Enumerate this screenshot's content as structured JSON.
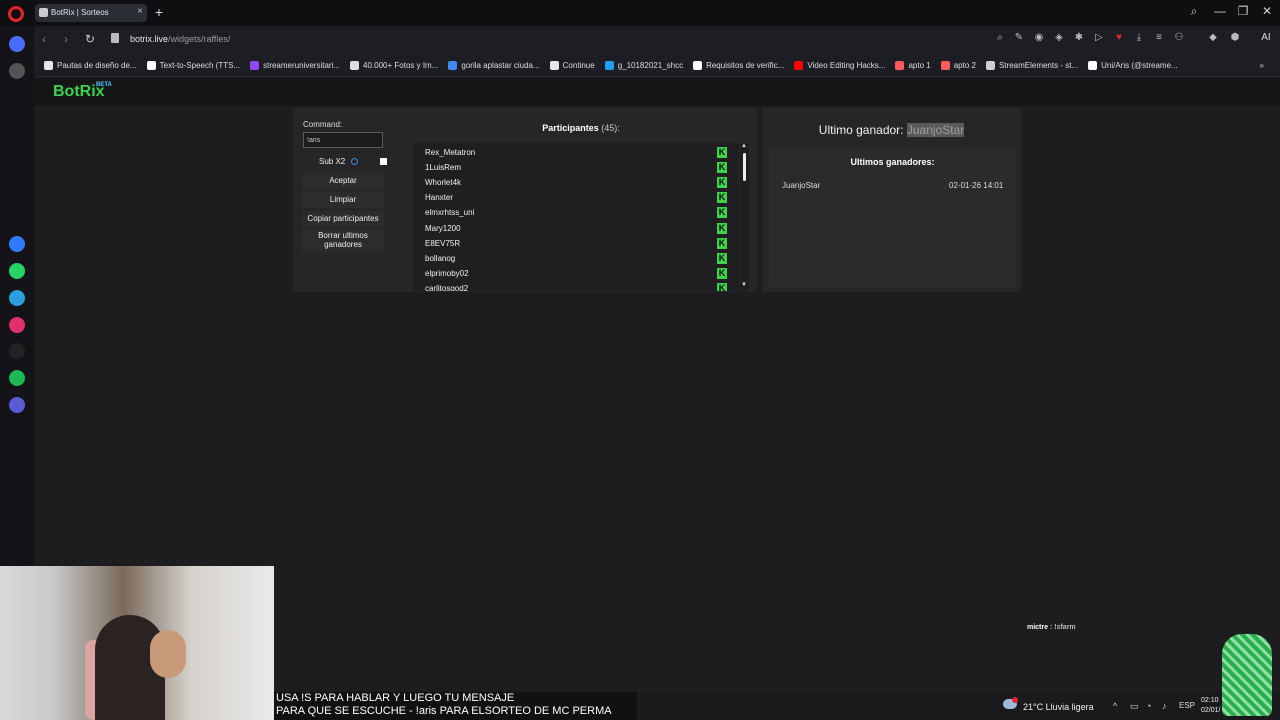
{
  "browser": {
    "tab_title": "BotRix | Sorteos",
    "tab_close": "×",
    "new_tab": "+",
    "url_host": "botrix.live",
    "url_path": "/widgets/raffles/",
    "ai_label": "AI",
    "window_controls": [
      "⌕",
      "—",
      "❐",
      "✕"
    ]
  },
  "bookmarks": [
    {
      "label": "Pautas de diseño de...",
      "color": "#e6e6e6"
    },
    {
      "label": "Text-to-Speech (TTS...",
      "color": "#ffffff"
    },
    {
      "label": "streameruniversitari...",
      "color": "#9146ff"
    },
    {
      "label": "40.000+ Fotos y Im...",
      "color": "#dddddd"
    },
    {
      "label": "gorila aplastar ciuda...",
      "color": "#4285f4"
    },
    {
      "label": "Continue",
      "color": "#e6e6e6"
    },
    {
      "label": "g_10182021_shcc",
      "color": "#1da1f2"
    },
    {
      "label": "Requisitos de verific...",
      "color": "#ffffff"
    },
    {
      "label": "Video Editing Hacks...",
      "color": "#ff0000"
    },
    {
      "label": "apto 1",
      "color": "#ff5a5f"
    },
    {
      "label": "apto 2",
      "color": "#ff5a5f"
    },
    {
      "label": "StreamElements - st...",
      "color": "#cfcfcf"
    },
    {
      "label": "Uni/Aris (@streame...",
      "color": "#ffffff"
    }
  ],
  "sidebar_icons": [
    {
      "name": "home-icon",
      "color": "#4b6bff"
    },
    {
      "name": "star-icon",
      "color": "#555"
    },
    {
      "name": "messenger-icon",
      "color": "#2f7bff"
    },
    {
      "name": "whatsapp-icon",
      "color": "#25d366"
    },
    {
      "name": "telegram-icon",
      "color": "#2aa0da"
    },
    {
      "name": "instagram-icon",
      "color": "#e1306c"
    },
    {
      "name": "x-icon",
      "color": "#222"
    },
    {
      "name": "spotify-icon",
      "color": "#1db954"
    },
    {
      "name": "player-icon",
      "color": "#5b5bd6"
    }
  ],
  "brand": {
    "name": "BotRix",
    "badge": "BETA",
    "accent": "#3fd14a"
  },
  "raffle": {
    "command_label": "Command:",
    "command_value": "!aris",
    "sub_label": "Sub X2",
    "sub_checked": true,
    "buttons": {
      "accept": "Aceptar",
      "clear": "Limpiar",
      "copy": "Copiar participantes",
      "delete_line1": "Borrar ultimos",
      "delete_line2": "ganadores"
    },
    "participants_title": "Participantes",
    "participants_count": "(45):",
    "participants": [
      "Rex_Metatron",
      "1LuisRem",
      "Whorlet4k",
      "Hanxter",
      "elmxrhtss_uni",
      "Mary1200",
      "E8EV75R",
      "bollanog",
      "elprimoby02",
      "carlitosgod2"
    ],
    "kick_icon": "K"
  },
  "winner": {
    "label": "Ultimo ganador:",
    "name": "JuanjoStar",
    "history_title": "Ultimos ganadores:",
    "history": [
      {
        "name": "JuanjoStar",
        "date": "02-01-26 14:01"
      }
    ]
  },
  "overlay": {
    "chat_user": "mictre",
    "chat_msg": ": !sfarm",
    "caption_line1": "USA !S PARA HABLAR Y LUEGO TU MENSAJE",
    "caption_line2": "PARA QUE SE ESCUCHE - !aris PARA ELSORTEO DE MC PERMA"
  },
  "taskbar": {
    "weather": "21°C  Lluvia ligera",
    "lang": "ESP",
    "time": "02:10",
    "date": "02/01/"
  }
}
